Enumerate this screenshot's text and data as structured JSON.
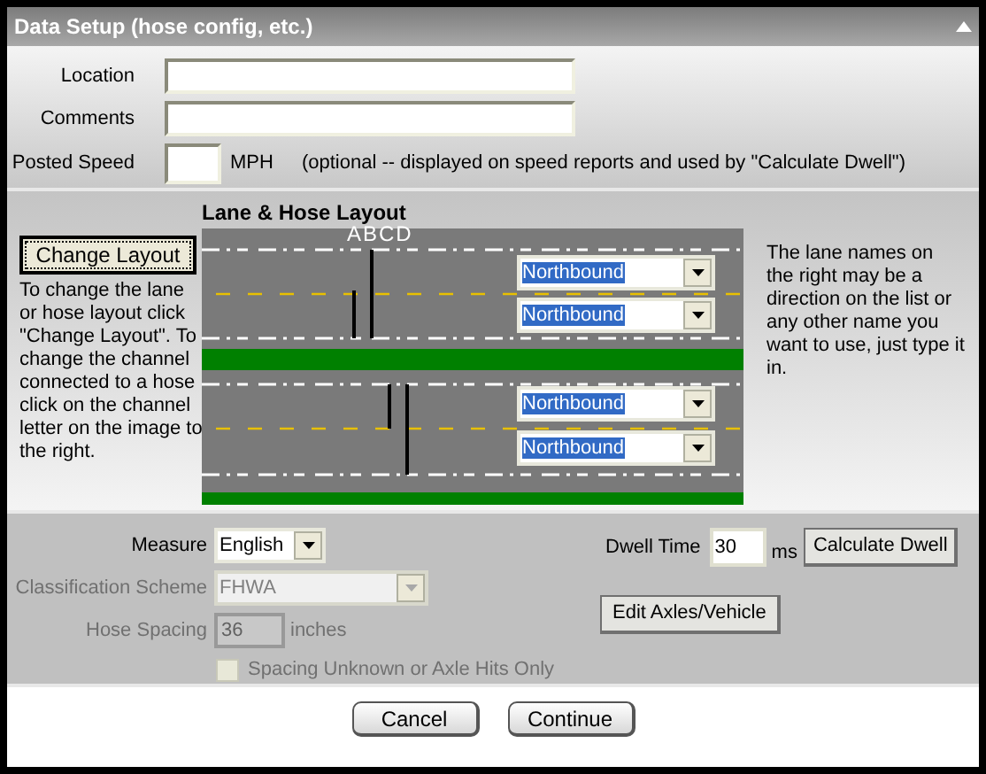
{
  "window": {
    "title": "Data Setup (hose config, etc.)"
  },
  "site": {
    "location_label": "Location",
    "comments_label": "Comments",
    "speed_label": "Posted Speed",
    "speed_unit": "MPH",
    "speed_note": "(optional -- displayed on speed reports and used by \"Calculate Dwell\")"
  },
  "layout": {
    "change_button": "Change Layout",
    "help": "To change the lane or hose layout click \"Change Layout\". To change the channel connected to a hose click on the channel letter on the image to the right.",
    "title": "Lane & Hose Layout",
    "channel_letters": "ABCD",
    "lane_help": "The lane names on the right may be a direction on the list or any other name you want to use, just type it in.",
    "lanes": [
      {
        "name": "Northbound",
        "highlighted": true
      },
      {
        "name": "Northbound",
        "highlighted": true
      },
      {
        "name": "Northbound",
        "highlighted": true
      },
      {
        "name": "Northbound",
        "highlighted": true
      }
    ]
  },
  "settings": {
    "measure": {
      "label": "Measure",
      "value": "English"
    },
    "classification": {
      "label": "Classification Scheme",
      "value": "FHWA",
      "disabled": true
    },
    "hose_spacing": {
      "label": "Hose Spacing",
      "value": "36",
      "unit": "inches",
      "disabled": true
    },
    "spacing_unknown": {
      "label": "Spacing Unknown or Axle Hits Only",
      "checked": false,
      "disabled": true
    },
    "dwell": {
      "label": "Dwell Time",
      "value": "30",
      "unit": "ms"
    },
    "calculate_button": "Calculate Dwell",
    "axles_button": "Edit Axles/Vehicle"
  },
  "buttons": [
    "Cancel",
    "Continue"
  ]
}
